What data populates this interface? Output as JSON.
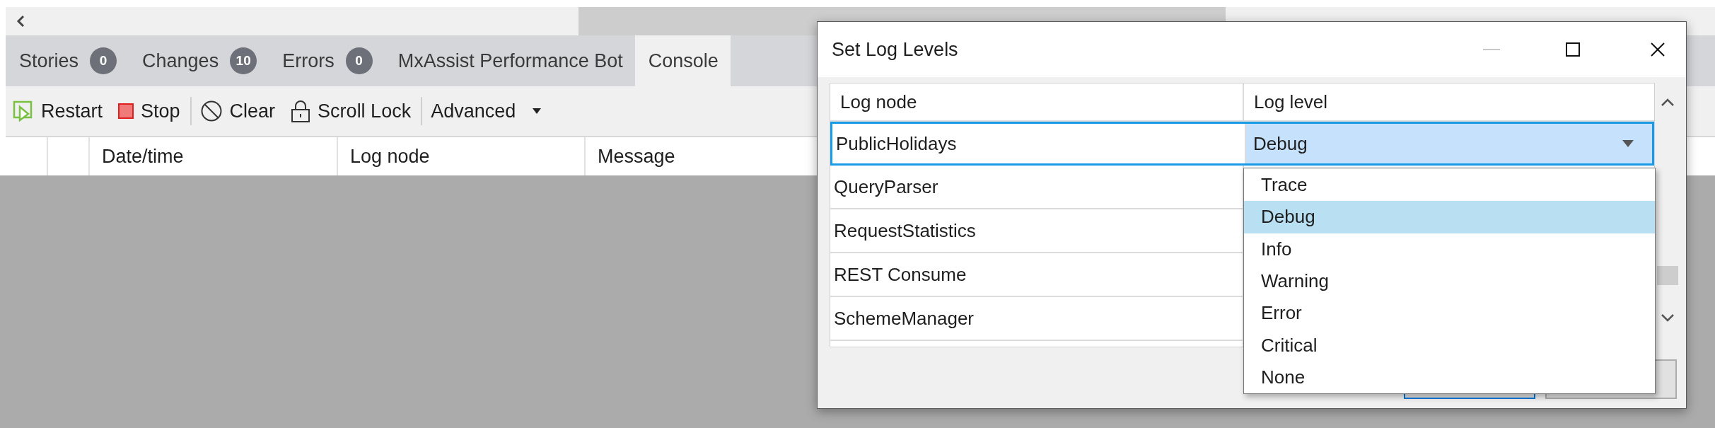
{
  "tabs": [
    {
      "label": "Stories",
      "count": "0",
      "selected": false
    },
    {
      "label": "Changes",
      "count": "10",
      "selected": false
    },
    {
      "label": "Errors",
      "count": "0",
      "selected": false
    },
    {
      "label": "MxAssist Performance Bot",
      "selected": false
    },
    {
      "label": "Console",
      "selected": true
    }
  ],
  "toolbar": [
    {
      "label": "Restart",
      "kind": "restart"
    },
    {
      "label": "Stop",
      "kind": "stop"
    },
    {
      "label": "Clear",
      "kind": "clear"
    },
    {
      "label": "Scroll Lock",
      "kind": "lock"
    },
    {
      "label": "Advanced",
      "kind": "menu"
    }
  ],
  "log_table": {
    "columns": [
      "Date/time",
      "Log node",
      "Message"
    ]
  },
  "dialog": {
    "title": "Set Log Levels",
    "columns": [
      "Log node",
      "Log level"
    ],
    "rows": [
      {
        "node": "PublicHolidays",
        "level": "Debug",
        "selected": true
      },
      {
        "node": "QueryParser",
        "selected": false
      },
      {
        "node": "RequestStatistics",
        "selected": false
      },
      {
        "node": "REST Consume",
        "selected": false
      },
      {
        "node": "SchemeManager",
        "selected": false
      }
    ],
    "level_options": [
      {
        "label": "Trace",
        "selected": false
      },
      {
        "label": "Debug",
        "selected": true
      },
      {
        "label": "Info",
        "selected": false
      },
      {
        "label": "Warning",
        "selected": false
      },
      {
        "label": "Error",
        "selected": false
      },
      {
        "label": "Critical",
        "selected": false
      },
      {
        "label": "None",
        "selected": false
      }
    ]
  }
}
